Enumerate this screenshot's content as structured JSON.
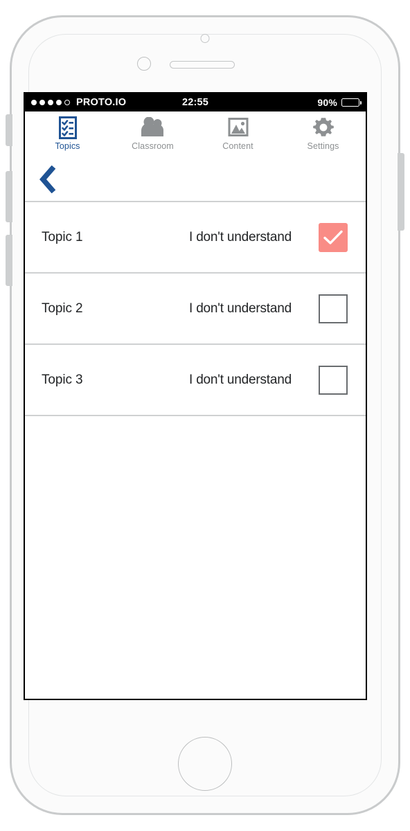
{
  "device": {
    "type": "smartphone-mockup",
    "frame_color": "#c9cbcc"
  },
  "status_bar": {
    "carrier": "PROTO.IO",
    "signal_filled_dots": 4,
    "signal_empty_dots": 1,
    "time": "22:55",
    "battery_percent": "90%",
    "battery_level": 90
  },
  "tab_bar": {
    "active_color": "#1f5394",
    "inactive_color": "#8d9092",
    "tabs": [
      {
        "label": "Topics",
        "icon": "checklist-icon",
        "active": true
      },
      {
        "label": "Classroom",
        "icon": "people-icon",
        "active": false
      },
      {
        "label": "Content",
        "icon": "image-icon",
        "active": false
      },
      {
        "label": "Settings",
        "icon": "gear-icon",
        "active": false
      }
    ]
  },
  "nav": {
    "back_icon": "chevron-left-icon",
    "back_color": "#1f5394"
  },
  "topics": {
    "checked_color": "#f98c86",
    "rows": [
      {
        "name": "Topic 1",
        "status": "I don't understand",
        "checked": true
      },
      {
        "name": "Topic 2",
        "status": "I don't understand",
        "checked": false
      },
      {
        "name": "Topic 3",
        "status": "I don't understand",
        "checked": false
      }
    ]
  }
}
